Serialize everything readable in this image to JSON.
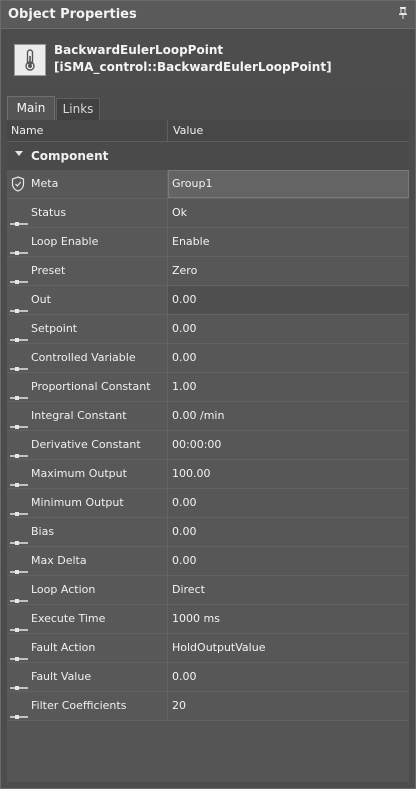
{
  "window": {
    "title": "Object Properties"
  },
  "object": {
    "name": "BackwardEulerLoopPoint",
    "type": "[iSMA_control::BackwardEulerLoopPoint]"
  },
  "tabs": [
    {
      "label": "Main",
      "active": true
    },
    {
      "label": "Links",
      "active": false
    }
  ],
  "table": {
    "columns": {
      "name": "Name",
      "value": "Value"
    },
    "group": "Component",
    "rows": [
      {
        "name": "Meta",
        "value": "Group1",
        "icon": "shield-icon"
      },
      {
        "name": "Status",
        "value": "Ok",
        "icon": "slot-icon"
      },
      {
        "name": "Loop Enable",
        "value": "Enable",
        "icon": "slot-icon"
      },
      {
        "name": "Preset",
        "value": "Zero",
        "icon": "slot-icon"
      },
      {
        "name": "Out",
        "value": "0.00",
        "icon": "slot-icon"
      },
      {
        "name": "Setpoint",
        "value": "0.00",
        "icon": "slot-icon"
      },
      {
        "name": "Controlled Variable",
        "value": "0.00",
        "icon": "slot-icon"
      },
      {
        "name": "Proportional Constant",
        "value": "1.00",
        "icon": "slot-icon"
      },
      {
        "name": "Integral Constant",
        "value": "0.00 /min",
        "icon": "slot-icon"
      },
      {
        "name": "Derivative Constant",
        "value": "00:00:00",
        "icon": "slot-icon"
      },
      {
        "name": "Maximum Output",
        "value": "100.00",
        "icon": "slot-icon"
      },
      {
        "name": "Minimum Output",
        "value": "0.00",
        "icon": "slot-icon"
      },
      {
        "name": "Bias",
        "value": "0.00",
        "icon": "slot-icon"
      },
      {
        "name": "Max Delta",
        "value": "0.00",
        "icon": "slot-icon"
      },
      {
        "name": "Loop Action",
        "value": "Direct",
        "icon": "slot-icon"
      },
      {
        "name": "Execute Time",
        "value": "1000 ms",
        "icon": "slot-icon"
      },
      {
        "name": "Fault Action",
        "value": "HoldOutputValue",
        "icon": "slot-icon"
      },
      {
        "name": "Fault Value",
        "value": "0.00",
        "icon": "slot-icon"
      },
      {
        "name": "Filter Coefficients",
        "value": "20",
        "icon": "slot-icon"
      }
    ]
  },
  "icons": {
    "pin": "pin-icon",
    "object": "thermometer-icon"
  }
}
